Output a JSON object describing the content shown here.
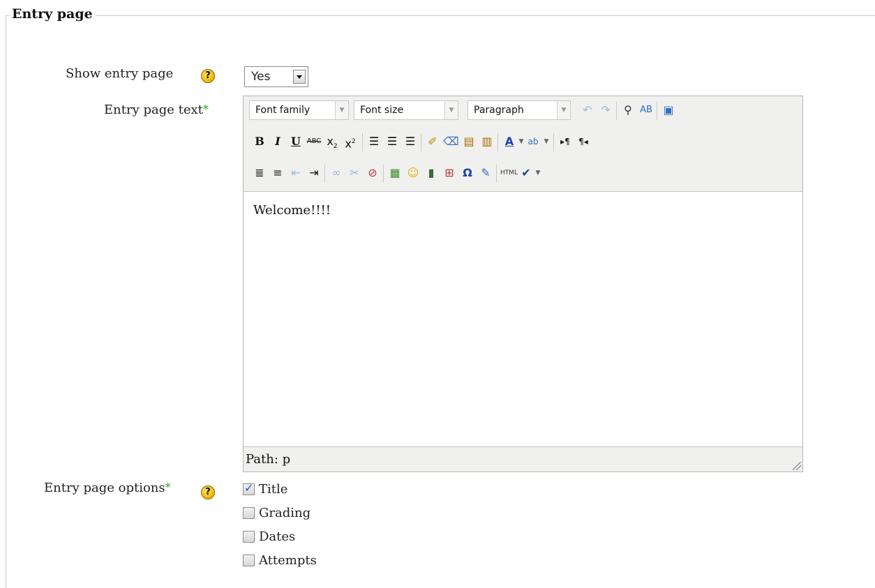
{
  "section": {
    "legend": "Entry page"
  },
  "show_entry_page": {
    "label": "Show entry page",
    "value": "Yes"
  },
  "entry_page_text": {
    "label": "Entry page text",
    "required_mark": "*",
    "toolbar": {
      "font_family": "Font family",
      "font_size": "Font size",
      "format": "Paragraph"
    },
    "content": "Welcome!!!!",
    "path": "Path: p"
  },
  "entry_page_options": {
    "label": "Entry page options",
    "required_mark": "*",
    "options": [
      {
        "label": "Title",
        "checked": true
      },
      {
        "label": "Grading",
        "checked": false
      },
      {
        "label": "Dates",
        "checked": false
      },
      {
        "label": "Attempts",
        "checked": false
      }
    ]
  }
}
